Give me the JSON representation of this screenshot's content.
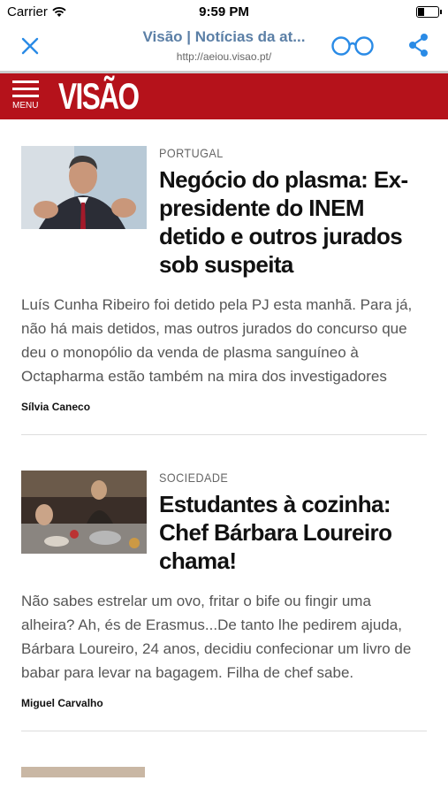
{
  "status": {
    "carrier": "Carrier",
    "time": "9:59 PM"
  },
  "nav": {
    "title": "Visão | Notícias da at...",
    "url": "http://aeiou.visao.pt/"
  },
  "brand": {
    "menu_label": "MENU",
    "logo": "VISÃO",
    "color": "#b5121b"
  },
  "articles": [
    {
      "section": "PORTUGAL",
      "headline": "Negócio do plasma: Ex-presidente do INEM detido e outros jurados sob suspeita",
      "excerpt": "Luís Cunha Ribeiro foi detido pela PJ esta manhã. Para já, não há mais detidos, mas outros jurados do concurso que deu o monopólio da venda de plasma sanguíneo à Octapharma estão também na mira dos investigadores",
      "author": "Sílvia Caneco"
    },
    {
      "section": "SOCIEDADE",
      "headline": "Estudantes à cozinha: Chef Bárbara Loureiro chama!",
      "excerpt": "Não sabes estrelar um ovo, fritar o bife ou fingir uma alheira? Ah, és de Erasmus...De tanto lhe pedirem ajuda, Bárbara Loureiro, 24 anos, decidiu confecionar um livro de babar para levar na bagagem. Filha de chef sabe.",
      "author": "Miguel Carvalho"
    }
  ]
}
